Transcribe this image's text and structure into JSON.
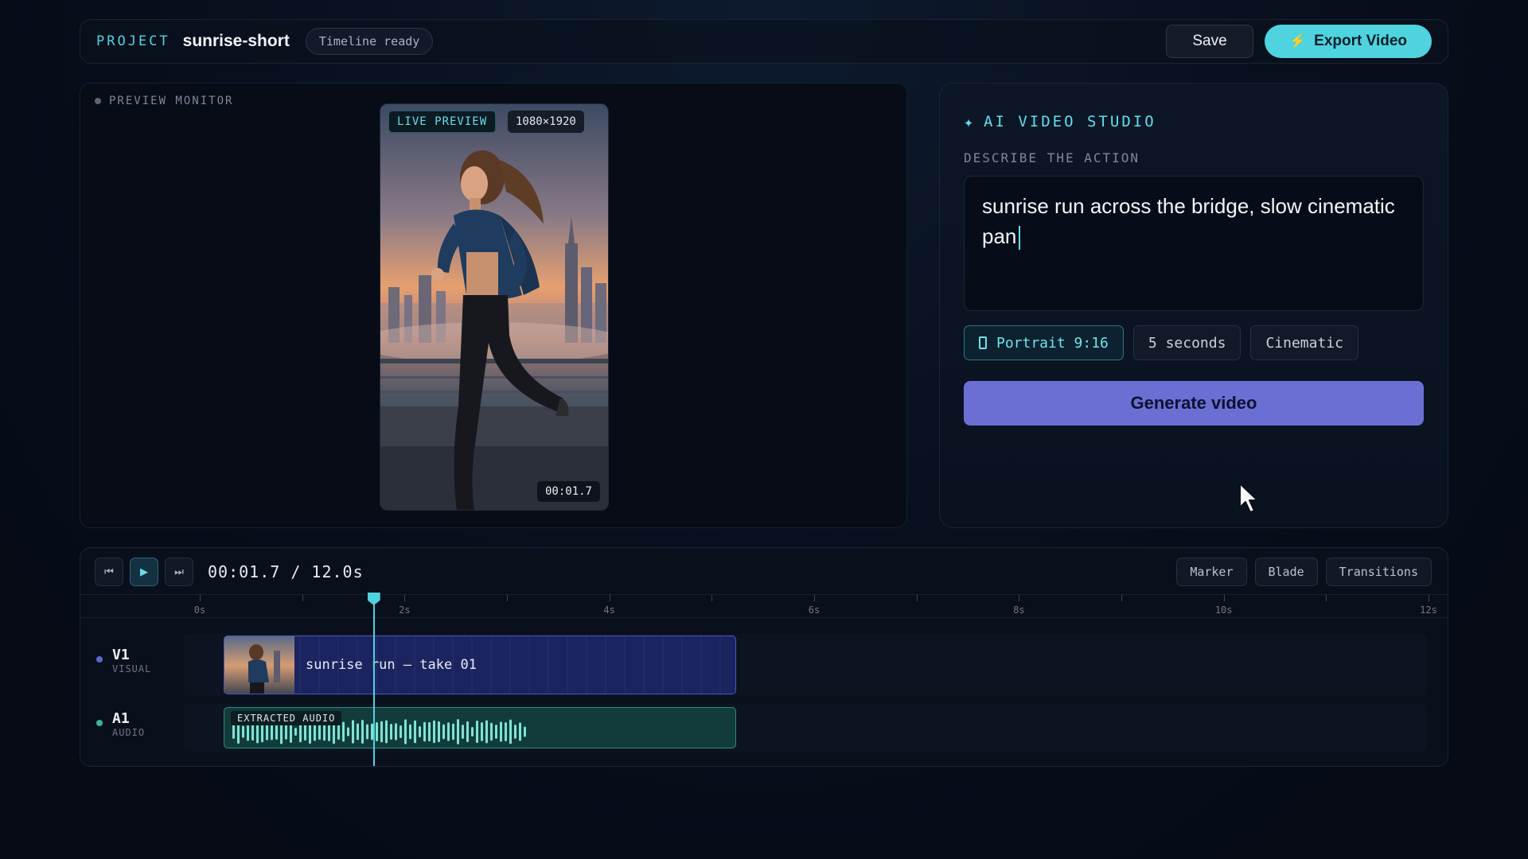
{
  "topbar": {
    "project_label": "PROJECT",
    "project_name": "sunrise-short",
    "status": "Timeline ready",
    "save_label": "Save",
    "export_label": "Export Video"
  },
  "preview": {
    "label": "PREVIEW MONITOR",
    "live_badge": "LIVE PREVIEW",
    "resolution": "1080×1920",
    "timecode": "00:01.7"
  },
  "studio": {
    "title": "AI VIDEO STUDIO",
    "describe_label": "DESCRIBE THE ACTION",
    "prompt_text": "sunrise run across the bridge, slow cinematic pan",
    "options": {
      "aspect": "Portrait 9:16",
      "duration": "5 seconds",
      "style": "Cinematic"
    },
    "generate_label": "Generate video"
  },
  "timeline": {
    "timecode": "00:01.7 / 12.0s",
    "tools": [
      "Marker",
      "Blade",
      "Transitions"
    ],
    "ruler_labels": [
      "0s",
      "2s",
      "4s",
      "6s",
      "8s",
      "10s",
      "12s"
    ],
    "playhead_seconds": 1.7,
    "duration_seconds": 12.0,
    "tracks": [
      {
        "name": "V1",
        "type": "VISUAL",
        "clip": "sunrise run — take 01"
      },
      {
        "name": "A1",
        "type": "AUDIO",
        "clip": "EXTRACTED AUDIO"
      }
    ]
  },
  "colors": {
    "accent": "#4fd3df",
    "generate": "#6b6fd4",
    "video_clip": "#1c2460",
    "audio_clip": "#123c3b"
  },
  "icons": [
    "bolt-icon",
    "sparkle-icon",
    "portrait-icon",
    "skip-back-icon",
    "play-icon",
    "skip-forward-icon",
    "mouse-cursor-icon"
  ]
}
